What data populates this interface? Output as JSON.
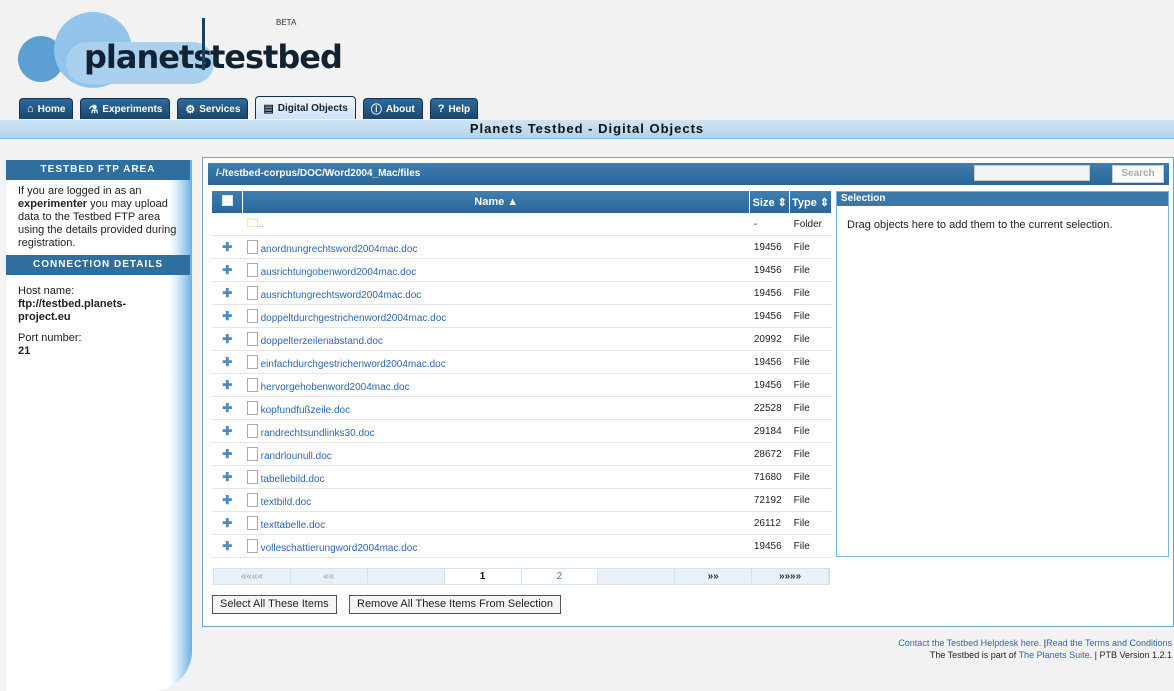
{
  "logo": {
    "word1": "planets",
    "word2": "testbed",
    "beta": "BETA"
  },
  "tabs": [
    {
      "label": "Home",
      "icon": "home-icon",
      "glyph": "⌂",
      "active": false
    },
    {
      "label": "Experiments",
      "icon": "flask-icon",
      "glyph": "⚗",
      "active": false
    },
    {
      "label": "Services",
      "icon": "gear-icon",
      "glyph": "⚙",
      "active": false
    },
    {
      "label": "Digital Objects",
      "icon": "drawer-icon",
      "glyph": "▤",
      "active": true
    },
    {
      "label": "About",
      "icon": "info-icon",
      "glyph": "ⓘ",
      "active": false
    },
    {
      "label": "Help",
      "icon": "help-icon",
      "glyph": "?",
      "active": false
    }
  ],
  "page_title": "Planets Testbed - Digital Objects",
  "sidebar": {
    "ftp_title": "TESTBED FTP AREA",
    "ftp_text_1": "If you are logged in as an",
    "ftp_bold": "experimenter",
    "ftp_text_2": " you may upload data to the Testbed FTP area using the details provided during registration.",
    "conn_title": "CONNECTION DETAILS",
    "host_label": "Host name:",
    "host_value": "ftp://testbed.planets-project.eu",
    "port_label": "Port number:",
    "port_value": "21"
  },
  "browser": {
    "path": "/-/testbed-corpus/DOC/Word2004_Mac/files",
    "search_placeholder": "",
    "search_button": "Search",
    "columns": {
      "name": "Name ▲",
      "size": "Size ⇕",
      "type": "Type ⇕"
    },
    "parent_row": {
      "name": "..",
      "size": "-",
      "type": "Folder"
    },
    "files": [
      {
        "name": "anordnungrechtsword2004mac.doc",
        "size": "19456",
        "type": "File"
      },
      {
        "name": "ausrichtungobenword2004mac.doc",
        "size": "19456",
        "type": "File"
      },
      {
        "name": "ausrichtungrechtsword2004mac.doc",
        "size": "19456",
        "type": "File"
      },
      {
        "name": "doppeltdurchgestrichenword2004mac.doc",
        "size": "19456",
        "type": "File"
      },
      {
        "name": "doppelterzeilenabstand.doc",
        "size": "20992",
        "type": "File"
      },
      {
        "name": "einfachdurchgestrichenword2004mac.doc",
        "size": "19456",
        "type": "File"
      },
      {
        "name": "hervorgehobenword2004mac.doc",
        "size": "19456",
        "type": "File"
      },
      {
        "name": "kopfundfußzeile.doc",
        "size": "22528",
        "type": "File"
      },
      {
        "name": "randrechtsundlinks30.doc",
        "size": "29184",
        "type": "File"
      },
      {
        "name": "randrlounull.doc",
        "size": "28672",
        "type": "File"
      },
      {
        "name": "tabellebild.doc",
        "size": "71680",
        "type": "File"
      },
      {
        "name": "textbild.doc",
        "size": "72192",
        "type": "File"
      },
      {
        "name": "texttabelle.doc",
        "size": "26112",
        "type": "File"
      },
      {
        "name": "volleschattierungword2004mac.doc",
        "size": "19456",
        "type": "File"
      }
    ],
    "pager": {
      "first": "««««",
      "prev": "««",
      "page1": "1",
      "page2": "2",
      "next": "»»",
      "last": "»»»»"
    },
    "select_all": "Select All These Items",
    "remove_all": "Remove All These Items From Selection"
  },
  "selection": {
    "title": "Selection",
    "hint": "Drag objects here to add them to the current selection."
  },
  "footer": {
    "line1_a": "Contact the Testbed Helpdesk here.",
    "line1_sep": " |",
    "line1_b": "Read the Terms and Conditions",
    "line2_a": "The Testbed is part of ",
    "line2_link": "The Planets Suite",
    "line2_b": ". | PTB Version 1.2.1"
  }
}
